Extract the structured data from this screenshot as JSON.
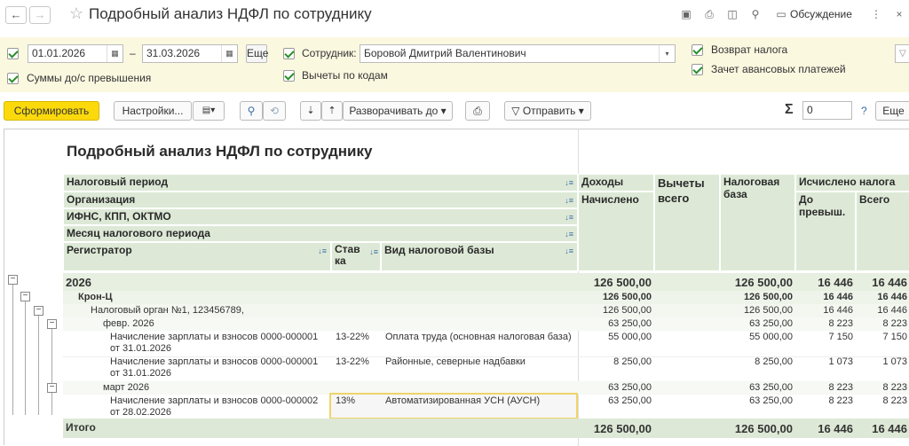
{
  "window": {
    "title": "Подробный анализ НДФЛ по сотруднику",
    "discuss_label": "Обсуждение"
  },
  "filters": {
    "date_from": "01.01.2026",
    "date_to": "31.03.2026",
    "date_dash": "–",
    "more_label": "...",
    "employee_label": "Сотрудник:",
    "employee_value": "Боровой Дмитрий Валентинович",
    "sums_over_label": "Суммы до/с превышения",
    "deductions_by_codes_label": "Вычеты по кодам",
    "tax_refund_label": "Возврат налога",
    "advance_offset_label": "Зачет авансовых платежей"
  },
  "toolbar": {
    "generate_label": "Сформировать",
    "settings_label": "Настройки...",
    "expand_label": "Разворачивать до",
    "send_label": "Отправить",
    "sum_value": "0",
    "help_label": "?",
    "more_label": "Еще"
  },
  "report": {
    "title": "Подробный анализ НДФЛ по сотруднику",
    "group_headers": [
      "Налоговый период",
      "Организация",
      "ИФНС, КПП, ОКТМО",
      "Месяц налогового периода",
      "Регистратор"
    ],
    "col_rate": "Став\nка",
    "col_base_type": "Вид налоговой базы",
    "col_income": "Доходы",
    "col_accrued": "Начислено",
    "col_deductions": "Вычеты\nвсего",
    "col_tax_base": "Налоговая\nбаза",
    "col_tax_calculated": "Исчислено налога",
    "col_before_excess": "До\nпревыш.",
    "col_total": "Всего",
    "rows": [
      {
        "label": "2026",
        "accrued": "126 500,00",
        "base": "126 500,00",
        "before": "16 446",
        "total": "16 446"
      },
      {
        "label": "Крон-Ц",
        "accrued": "126 500,00",
        "base": "126 500,00",
        "before": "16 446",
        "total": "16 446"
      },
      {
        "label": "Налоговый орган №1, 123456789,",
        "accrued": "126 500,00",
        "base": "126 500,00",
        "before": "16 446",
        "total": "16 446"
      },
      {
        "label": "февр. 2026",
        "accrued": "63 250,00",
        "base": "63 250,00",
        "before": "8 223",
        "total": "8 223"
      },
      {
        "label": "Начисление зарплаты и взносов 0000-000001\nот 31.01.2026",
        "rate": "13-22%",
        "base_type": "Оплата труда (основная налоговая база)",
        "accrued": "55 000,00",
        "base": "55 000,00",
        "before": "7 150",
        "total": "7 150"
      },
      {
        "label": "Начисление зарплаты и взносов 0000-000001\nот 31.01.2026",
        "rate": "13-22%",
        "base_type": "Районные, северные надбавки",
        "accrued": "8 250,00",
        "base": "8 250,00",
        "before": "1 073",
        "total": "1 073"
      },
      {
        "label": "март 2026",
        "accrued": "63 250,00",
        "base": "63 250,00",
        "before": "8 223",
        "total": "8 223"
      },
      {
        "label": "Начисление зарплаты и взносов 0000-000002\nот 28.02.2026",
        "rate": "13%",
        "base_type": "Автоматизированная УСН (АУСН)",
        "accrued": "63 250,00",
        "base": "63 250,00",
        "before": "8 223",
        "total": "8 223"
      }
    ],
    "total_row": {
      "label": "Итого",
      "accrued": "126 500,00",
      "base": "126 500,00",
      "before": "16 446",
      "total": "16 446"
    }
  }
}
